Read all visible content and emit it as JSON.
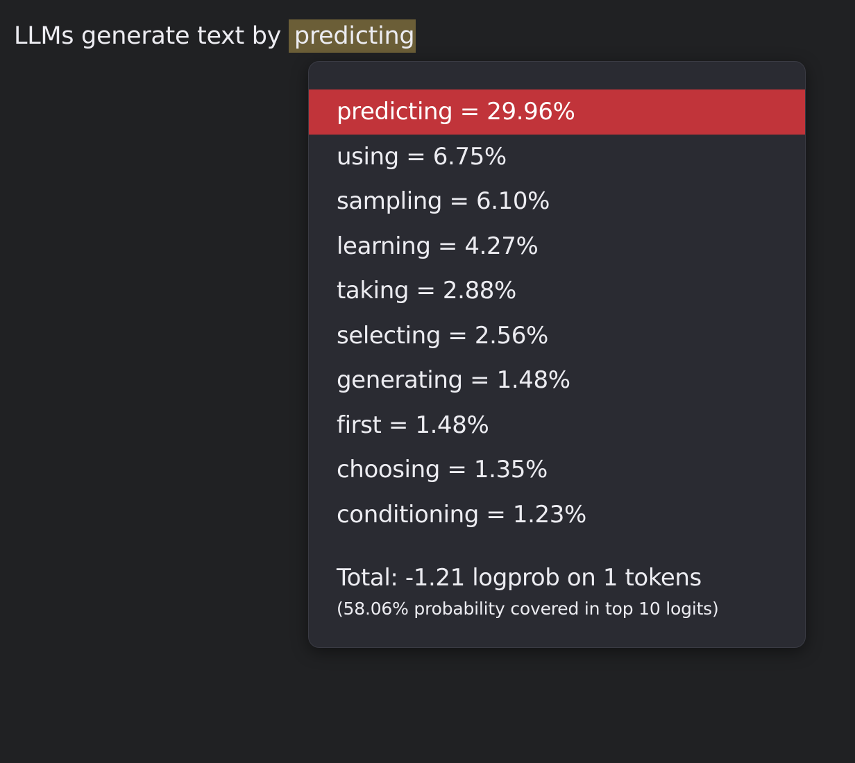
{
  "editor": {
    "prefix_text": "LLMs generate text by ",
    "highlighted_token": "predicting",
    "highlight_color": "#6b5e37"
  },
  "popup": {
    "selected_color": "#c1343a",
    "options": [
      {
        "label": "predicting = 29.96%",
        "token": "predicting",
        "probability": 29.96,
        "selected": true
      },
      {
        "label": "using = 6.75%",
        "token": "using",
        "probability": 6.75,
        "selected": false
      },
      {
        "label": "sampling = 6.10%",
        "token": "sampling",
        "probability": 6.1,
        "selected": false
      },
      {
        "label": "learning = 4.27%",
        "token": "learning",
        "probability": 4.27,
        "selected": false
      },
      {
        "label": "taking = 2.88%",
        "token": "taking",
        "probability": 2.88,
        "selected": false
      },
      {
        "label": "selecting = 2.56%",
        "token": "selecting",
        "probability": 2.56,
        "selected": false
      },
      {
        "label": "generating = 1.48%",
        "token": "generating",
        "probability": 1.48,
        "selected": false
      },
      {
        "label": "first = 1.48%",
        "token": "first",
        "probability": 1.48,
        "selected": false
      },
      {
        "label": "choosing = 1.35%",
        "token": "choosing",
        "probability": 1.35,
        "selected": false
      },
      {
        "label": "conditioning = 1.23%",
        "token": "conditioning",
        "probability": 1.23,
        "selected": false
      }
    ],
    "total_text": "Total: -1.21 logprob on 1 tokens",
    "coverage_text": "(58.06% probability covered in top 10 logits)"
  }
}
